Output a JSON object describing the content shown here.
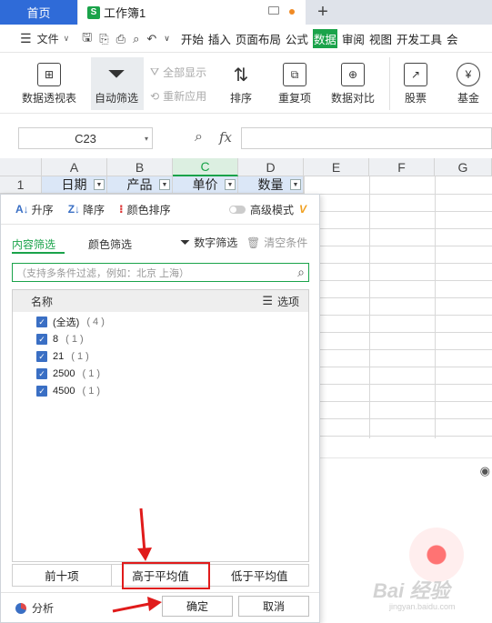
{
  "tabs": {
    "home": "首页",
    "workbook": "工作簿1",
    "workbook_icon": "S",
    "add": "+"
  },
  "menu": {
    "file": "文件",
    "items": [
      "开始",
      "插入",
      "页面布局",
      "公式",
      "数据",
      "审阅",
      "视图",
      "开发工具",
      "会"
    ],
    "active_index": 4,
    "active_color": "#1aa34a"
  },
  "ribbon": {
    "pivot": "数据透视表",
    "autofilter": "自动筛选",
    "show_all": "全部显示",
    "reapply": "重新应用",
    "sort": "排序",
    "duplicates": "重复项",
    "compare": "数据对比",
    "stocks": "股票",
    "fund": "基金"
  },
  "formula": {
    "namebox": "C23",
    "fx": "fx"
  },
  "sheet": {
    "columns": [
      "A",
      "B",
      "C",
      "D",
      "E",
      "F",
      "G"
    ],
    "row1_number": "1",
    "headers": [
      "日期",
      "产品",
      "单价",
      "数量"
    ]
  },
  "filter_panel": {
    "sort_asc": "升序",
    "sort_desc": "降序",
    "sort_color": "颜色排序",
    "advanced": "高级模式",
    "tab_content": "内容筛选",
    "tab_color": "颜色筛选",
    "number_filter": "数字筛选",
    "clear": "清空条件",
    "search_placeholder": "（支持多条件过滤，例如：北京  上海）",
    "list_header": "名称",
    "options": "选项",
    "items": [
      {
        "label": "(全选)",
        "count": "( 4 )"
      },
      {
        "label": "8",
        "count": "( 1 )"
      },
      {
        "label": "21",
        "count": "( 1 )"
      },
      {
        "label": "2500",
        "count": "( 1 )"
      },
      {
        "label": "4500",
        "count": "( 1 )"
      }
    ],
    "top10": "前十项",
    "above_avg": "高于平均值",
    "below_avg": "低于平均值",
    "analyze": "分析",
    "ok": "确定",
    "cancel": "取消"
  },
  "watermark": {
    "text": "Bai 经验",
    "sub": "jingyan.baidu.com"
  }
}
